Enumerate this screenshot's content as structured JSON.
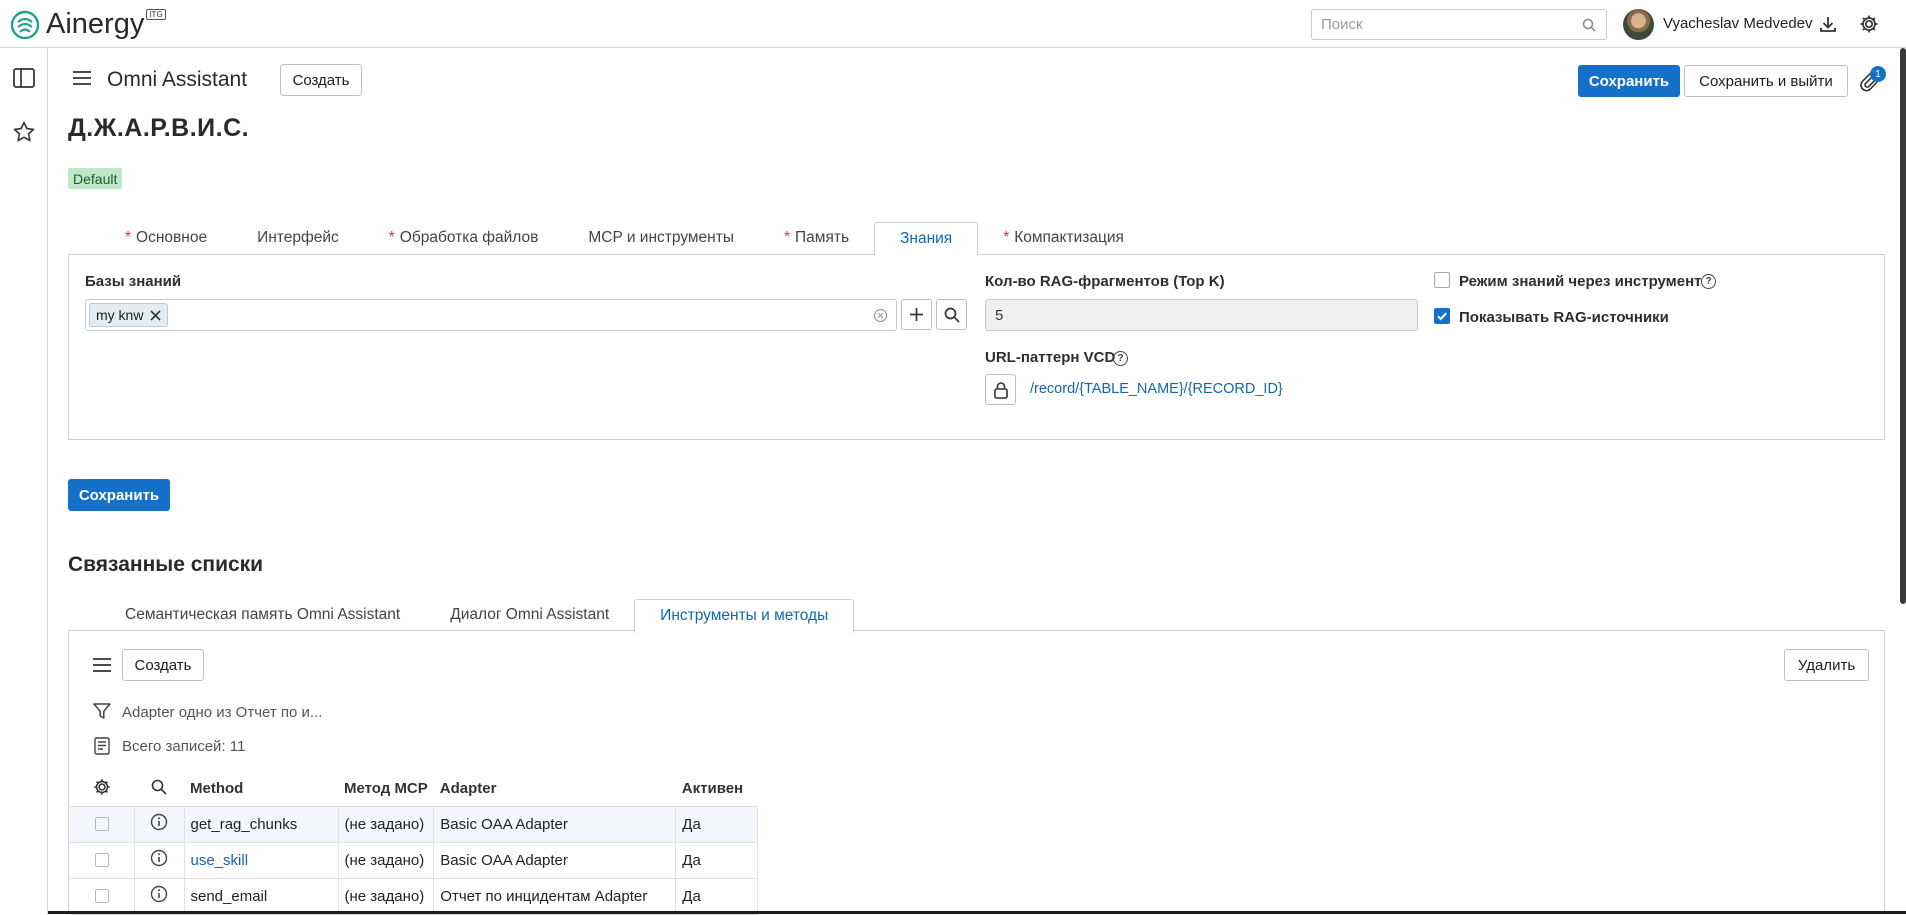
{
  "app": {
    "brand": "Ainergy",
    "brand_badge": "ITG"
  },
  "topbar": {
    "search_placeholder": "Поиск",
    "user_name": "Vyacheslav Medvedev"
  },
  "header": {
    "title": "Omni Assistant",
    "create_label": "Создать",
    "save_label": "Сохранить",
    "save_exit_label": "Сохранить и выйти",
    "attachments_count": "1"
  },
  "record": {
    "title": "Д.Ж.А.Р.В.И.С.",
    "tag": "Default"
  },
  "form_tabs": [
    {
      "label": "Основное",
      "required": "*"
    },
    {
      "label": "Интерфейс",
      "required": ""
    },
    {
      "label": "Обработка файлов",
      "required": "*"
    },
    {
      "label": "MCP и инструменты",
      "required": ""
    },
    {
      "label": "Память",
      "required": "*"
    },
    {
      "label": "Знания",
      "required": ""
    },
    {
      "label": "Компактизация",
      "required": "*"
    }
  ],
  "knowledge": {
    "kb_label": "Базы знаний",
    "kb_chip": "my knw",
    "topk_label": "Кол-во RAG-фрагментов (Top K)",
    "topk_value": "5",
    "url_label": "URL-паттерн VCD",
    "url_value": "/record/{TABLE_NAME}/{RECORD_ID}",
    "tool_mode_label": "Режим знаний через инструмент",
    "tool_mode_checked": false,
    "show_sources_label": "Показывать RAG-источники",
    "show_sources_checked": true
  },
  "form_save_label": "Сохранить",
  "related": {
    "title": "Связанные списки",
    "tabs": [
      "Семантическая память Omni Assistant",
      "Диалог Omni Assistant",
      "Инструменты и методы"
    ],
    "create_label": "Создать",
    "delete_label": "Удалить",
    "filter_text": "Adapter одно из Отчет по и...",
    "total_text": "Всего записей: 11",
    "columns": [
      "Method",
      "Метод MCP",
      "Adapter",
      "Активен"
    ],
    "rows": [
      {
        "method": "get_rag_chunks",
        "mcp": "(не задано)",
        "adapter": "Basic OAA Adapter",
        "active": "Да"
      },
      {
        "method": "use_skill",
        "mcp": "(не задано)",
        "adapter": "Basic OAA Adapter",
        "active": "Да"
      },
      {
        "method": "send_email",
        "mcp": "(не задано)",
        "adapter": "Отчет по инцидентам Adapter",
        "active": "Да"
      }
    ]
  },
  "colors": {
    "accent": "#1470c8",
    "tag_bg": "#bfe8c9",
    "required": "#d13b3b"
  }
}
